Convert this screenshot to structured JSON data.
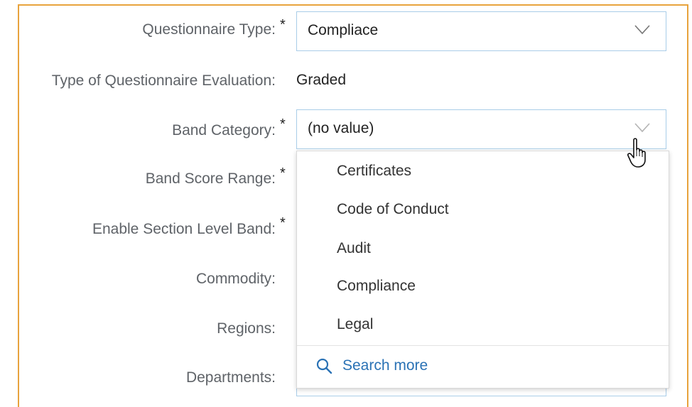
{
  "form": {
    "questionnaire_type": {
      "label": "Questionnaire Type:",
      "required": "*",
      "value": "Compliace"
    },
    "evaluation_type": {
      "label": "Type of Questionnaire Evaluation:",
      "value": "Graded"
    },
    "band_category": {
      "label": "Band Category:",
      "required": "*",
      "value": "(no value)"
    },
    "band_score_range": {
      "label": "Band Score Range:",
      "required": "*"
    },
    "section_level_band": {
      "label": "Enable Section Level Band:",
      "required": "*"
    },
    "commodity": {
      "label": "Commodity:"
    },
    "regions": {
      "label": "Regions:"
    },
    "departments": {
      "label": "Departments:"
    }
  },
  "dropdown": {
    "options": [
      "Certificates",
      "Code of Conduct",
      "Audit",
      "Compliance",
      "Legal"
    ],
    "search_more": "Search more"
  },
  "icons": {
    "chevron": "chevron-down-icon",
    "search": "search-icon",
    "cursor": "hand-pointer-icon"
  },
  "colors": {
    "frame": "#e8a33d",
    "field_border": "#a9cde8",
    "link": "#2a72b5"
  }
}
